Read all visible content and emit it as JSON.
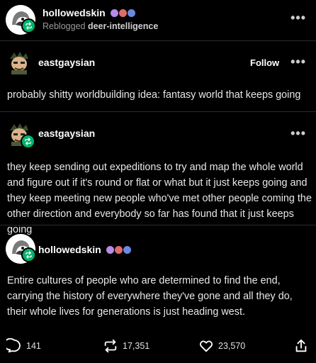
{
  "header": {
    "username": "hollowedskin",
    "reblogged_prefix": "Reblogged",
    "reblogged_from": "deer-intelligence",
    "more_label": "•••"
  },
  "post1": {
    "username": "eastgaysian",
    "follow_label": "Follow",
    "more_label": "•••",
    "text": "probably shitty worldbuilding idea: fantasy world that keeps going"
  },
  "post2": {
    "username": "eastgaysian",
    "more_label": "•••",
    "text": "they keep sending out expeditions to try and map the whole world and figure out if it's round or flat or what but it just keeps going and they keep meeting new people who've met other people coming the other direction and everybody so far has found that it just keeps going"
  },
  "post3": {
    "username": "hollowedskin",
    "text": "Entire cultures of people who are determined to find the end, carrying the history of everywhere they've gone and all they do, their whole lives for generations is just heading west."
  },
  "footer": {
    "replies": "141",
    "reblogs": "17,351",
    "likes": "23,570"
  },
  "colors": {
    "background": "#000000",
    "reblog_green": "#00b36b",
    "divider": "#2b2b2b"
  },
  "icons": [
    "reblog-icon",
    "reply-icon",
    "like-icon",
    "share-icon",
    "more-icon"
  ]
}
